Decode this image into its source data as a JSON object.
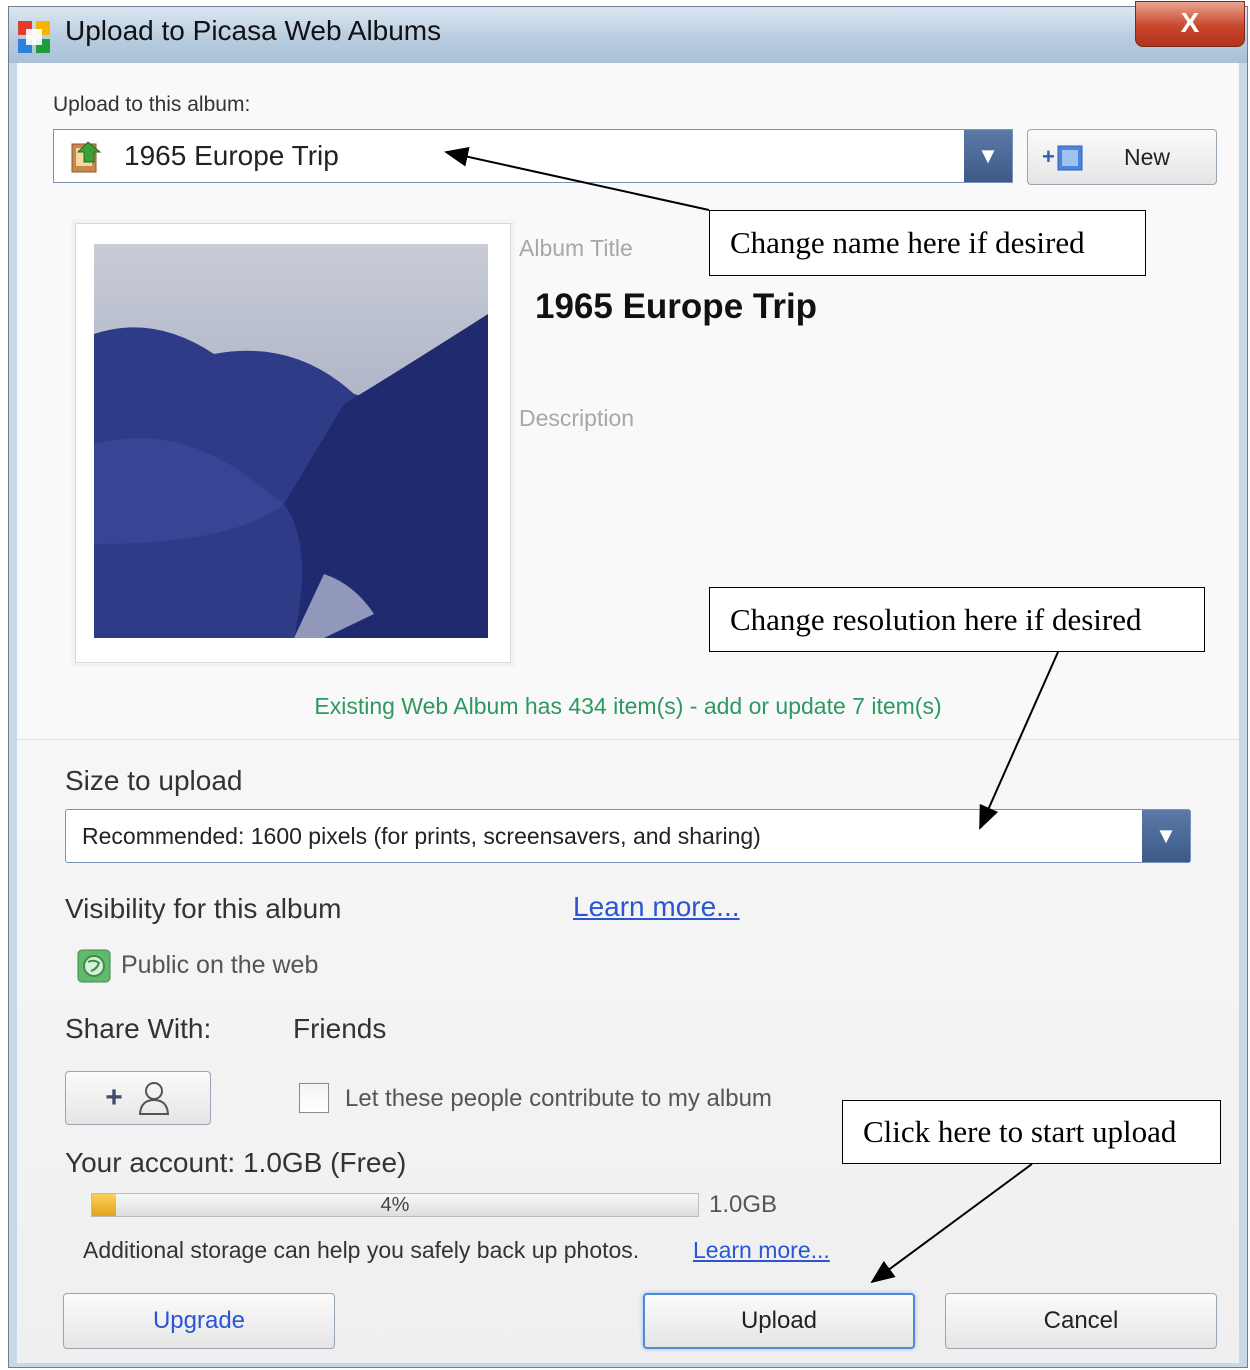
{
  "window": {
    "title": "Upload to Picasa Web Albums",
    "close_glyph": "X"
  },
  "album": {
    "label": "Upload to this album:",
    "selected": "1965 Europe Trip",
    "new_button": "New",
    "title_label": "Album Title",
    "title_value": "1965 Europe Trip",
    "description_label": "Description",
    "status": "Existing Web Album has 434 item(s) - add or update 7 item(s)"
  },
  "size": {
    "label": "Size to upload",
    "selected": "Recommended: 1600 pixels (for prints, screensavers, and sharing)"
  },
  "visibility": {
    "label": "Visibility for this album",
    "learn_more": "Learn more...",
    "value": "Public on the web"
  },
  "share": {
    "label": "Share With:",
    "value": "Friends",
    "add_people_glyph": "+",
    "contribute_label": "Let these people contribute to my album",
    "contribute_checked": false
  },
  "account": {
    "label": "Your account:  1.0GB  (Free)",
    "used_percent_text": "4%",
    "used_fraction": 0.04,
    "total": "1.0GB",
    "storage_note": "Additional storage can help you safely back up photos.",
    "storage_learn_more": "Learn more..."
  },
  "buttons": {
    "upgrade": "Upgrade",
    "upload": "Upload",
    "cancel": "Cancel"
  },
  "callouts": {
    "name": "Change name here if desired",
    "resolution": "Change resolution here if desired",
    "upload": "Click here to start upload"
  },
  "icons": [
    "picasa-logo-icon",
    "close-icon",
    "album-icon",
    "chevron-down-icon",
    "new-album-icon",
    "public-globe-icon",
    "add-person-icon",
    "checkbox-icon"
  ],
  "colors": {
    "link": "#2a55d4",
    "status": "#2f9862",
    "accent": "#3d5a87",
    "progress": "#e3a21b"
  }
}
